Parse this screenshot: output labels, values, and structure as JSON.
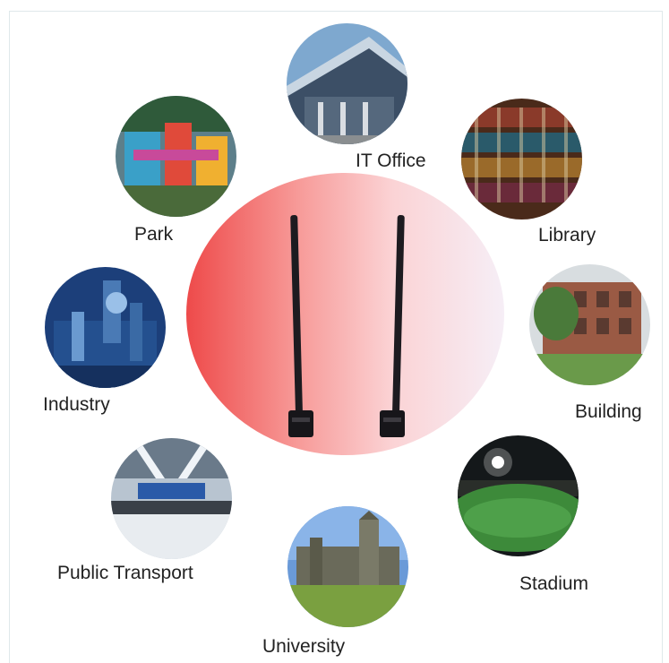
{
  "labels": {
    "it_office": "IT Office",
    "park": "Park",
    "library": "Library",
    "industry": "Industry",
    "building": "Building",
    "public_transport": "Public Transport",
    "stadium": "Stadium",
    "university": "University"
  },
  "colors": {
    "center_left": "#ee4a4a",
    "center_right": "#f6eef6",
    "antenna": "#1d1b20"
  }
}
